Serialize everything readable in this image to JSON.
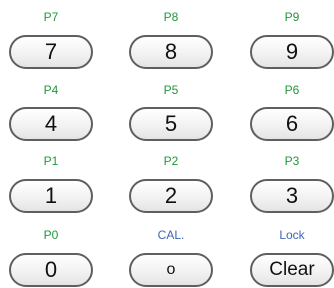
{
  "rows": [
    {
      "labels": [
        "P7",
        "P8",
        "P9"
      ],
      "keys": [
        "7",
        "8",
        "9"
      ]
    },
    {
      "labels": [
        "P4",
        "P5",
        "P6"
      ],
      "keys": [
        "4",
        "5",
        "6"
      ]
    },
    {
      "labels": [
        "P1",
        "P2",
        "P3"
      ],
      "keys": [
        "1",
        "2",
        "3"
      ]
    },
    {
      "labels": [
        "P0",
        "CAL.",
        "Lock"
      ],
      "keys": [
        "0",
        "o",
        "Clear"
      ]
    }
  ],
  "colors": {
    "preset_label": "#24963e",
    "function_label": "#3f66b8",
    "key_border": "#5f5f5f"
  }
}
